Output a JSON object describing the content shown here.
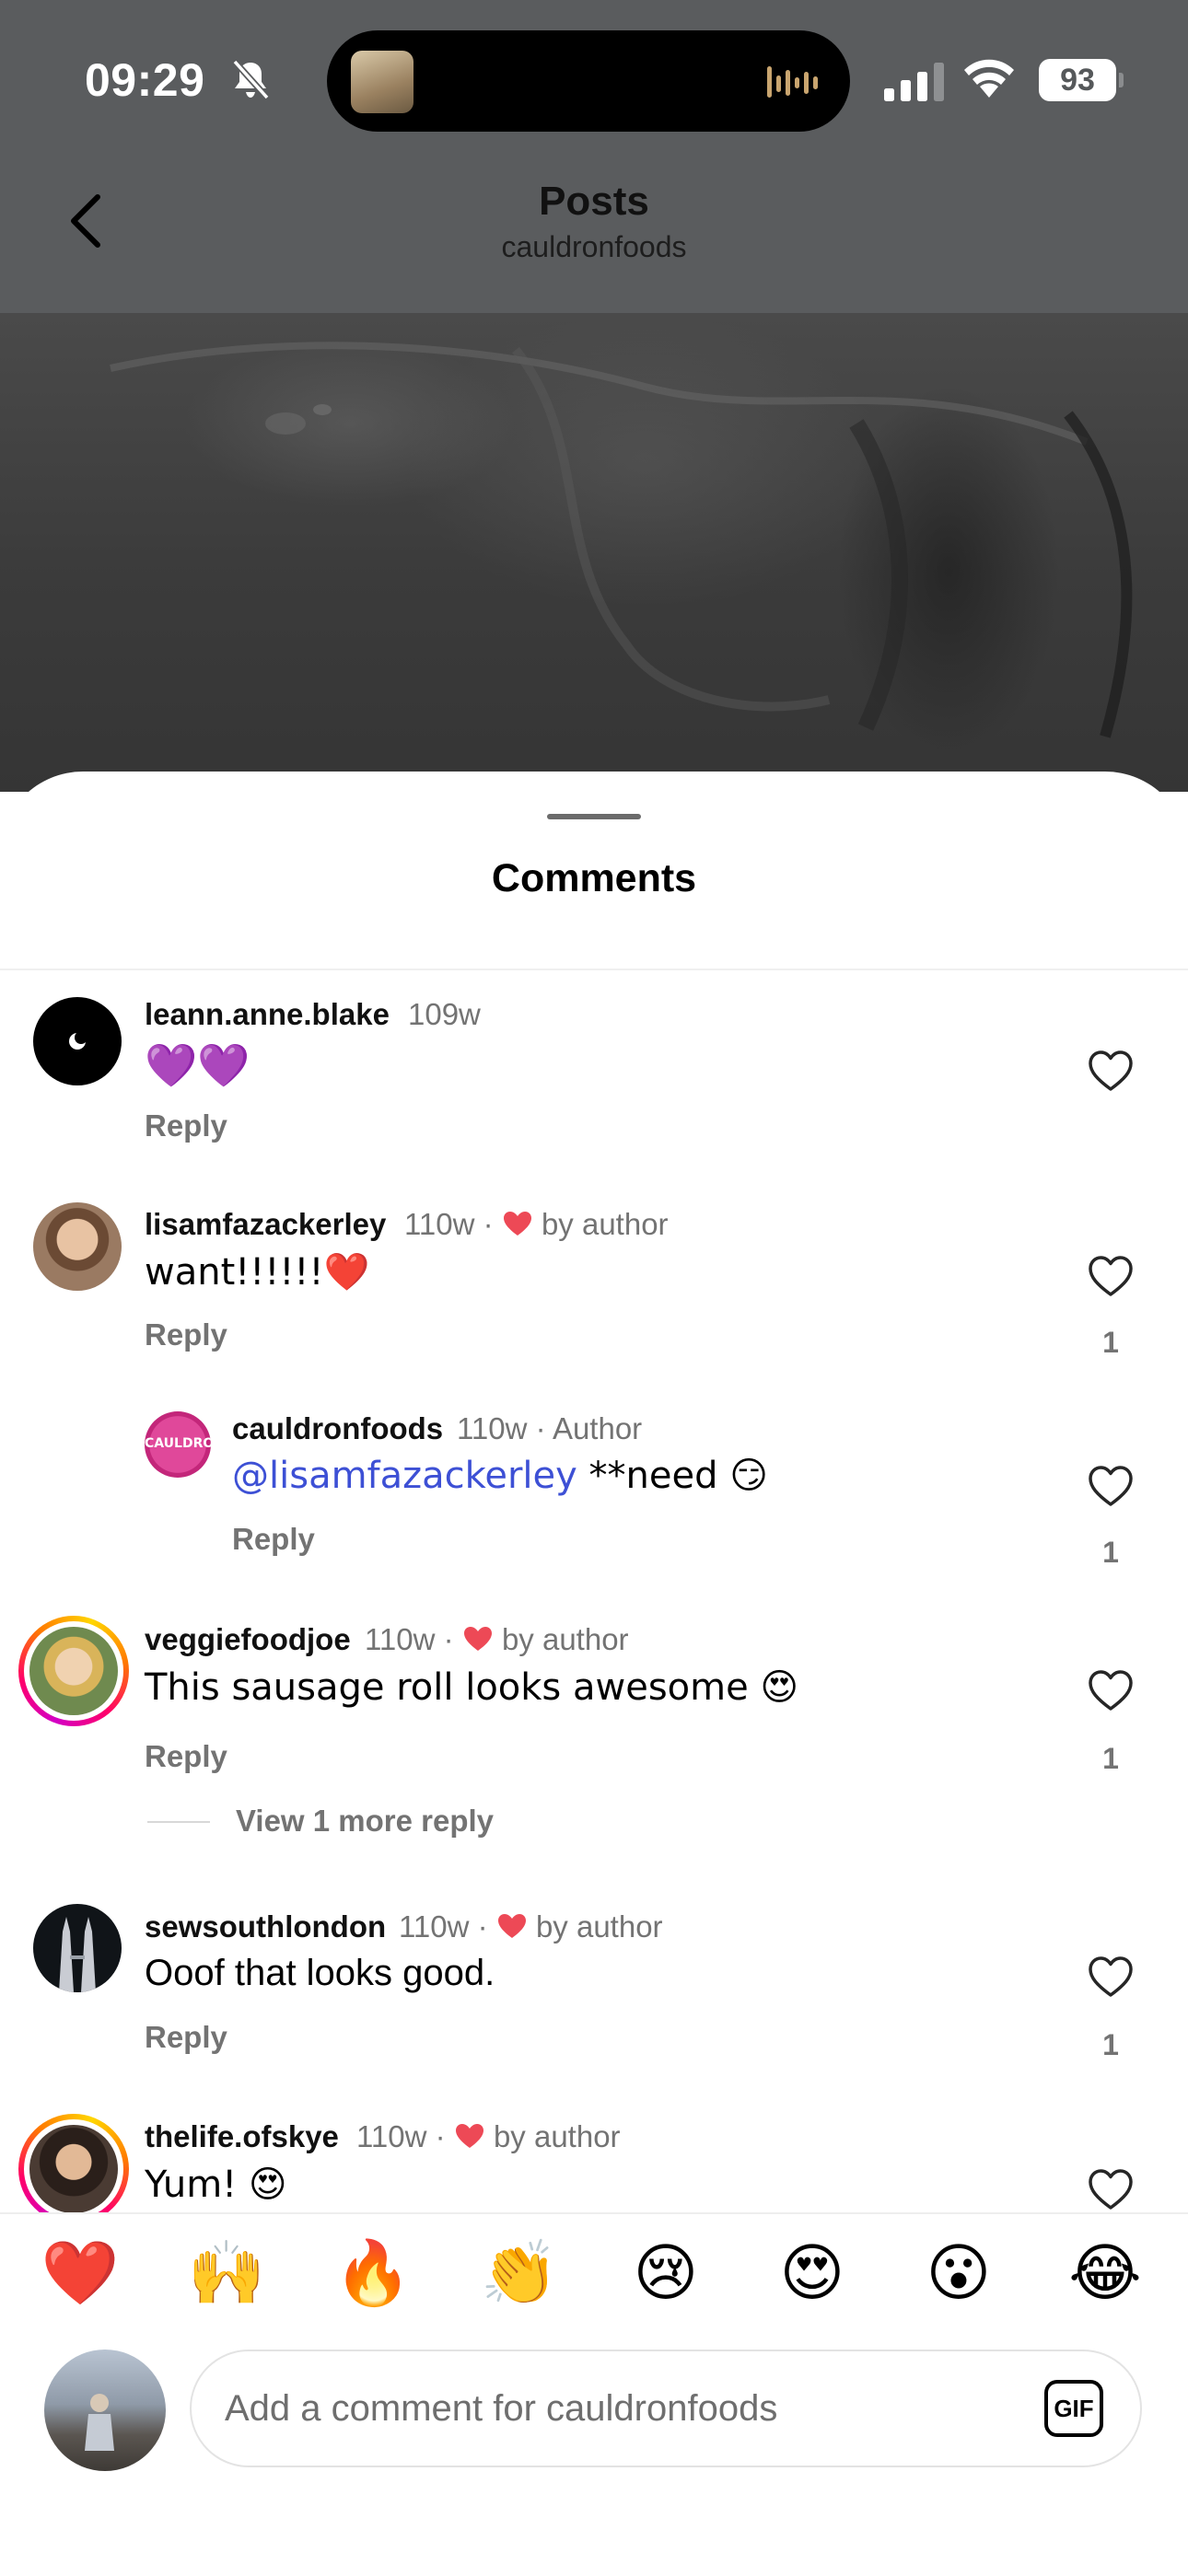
{
  "status_bar": {
    "time": "09:29",
    "battery": "93",
    "icons": [
      "bell-slash-icon",
      "now-playing-artwork",
      "audio-waveform-icon",
      "cellular-signal-icon",
      "wifi-icon",
      "battery-icon"
    ]
  },
  "nav": {
    "title": "Posts",
    "subtitle": "cauldronfoods",
    "back_icon": "chevron-left-icon"
  },
  "sheet": {
    "title": "Comments"
  },
  "comments": [
    {
      "username": "leann.anne.blake",
      "time": "109w",
      "text": "💜💜",
      "reply_label": "Reply"
    },
    {
      "username": "lisamfazackerley",
      "time": "110w ·",
      "liked_by_author": "by author",
      "text": "want!!!!!!❤️",
      "reply_label": "Reply",
      "likes": "1"
    },
    {
      "username": "cauldronfoods",
      "time": "110w · Author",
      "mention": "@lisamfazackerley",
      "text": " **need 😏",
      "reply_label": "Reply",
      "likes": "1"
    },
    {
      "username": "veggiefoodjoe",
      "time": "110w ·",
      "liked_by_author": "by author",
      "text": "This sausage roll looks awesome 😍",
      "reply_label": "Reply",
      "likes": "1",
      "view_more": "View 1 more reply"
    },
    {
      "username": "sewsouthlondon",
      "time": "110w ·",
      "liked_by_author": "by author",
      "text": "Ooof that looks good.",
      "reply_label": "Reply",
      "likes": "1"
    },
    {
      "username": "thelife.ofskye",
      "time": "110w ·",
      "liked_by_author": "by author",
      "text": "Yum! 😍"
    }
  ],
  "quick_reactions": [
    "❤️",
    "🙌",
    "🔥",
    "👏",
    "😢",
    "😍",
    "😮",
    "😂"
  ],
  "composer": {
    "placeholder": "Add a comment for cauldronfoods",
    "gif_label": "GIF"
  },
  "colors": {
    "heart_red": "#ed4956",
    "mention_blue": "#3d50d5",
    "secondary_text": "#737373",
    "overlay": "#5a5c5e"
  }
}
